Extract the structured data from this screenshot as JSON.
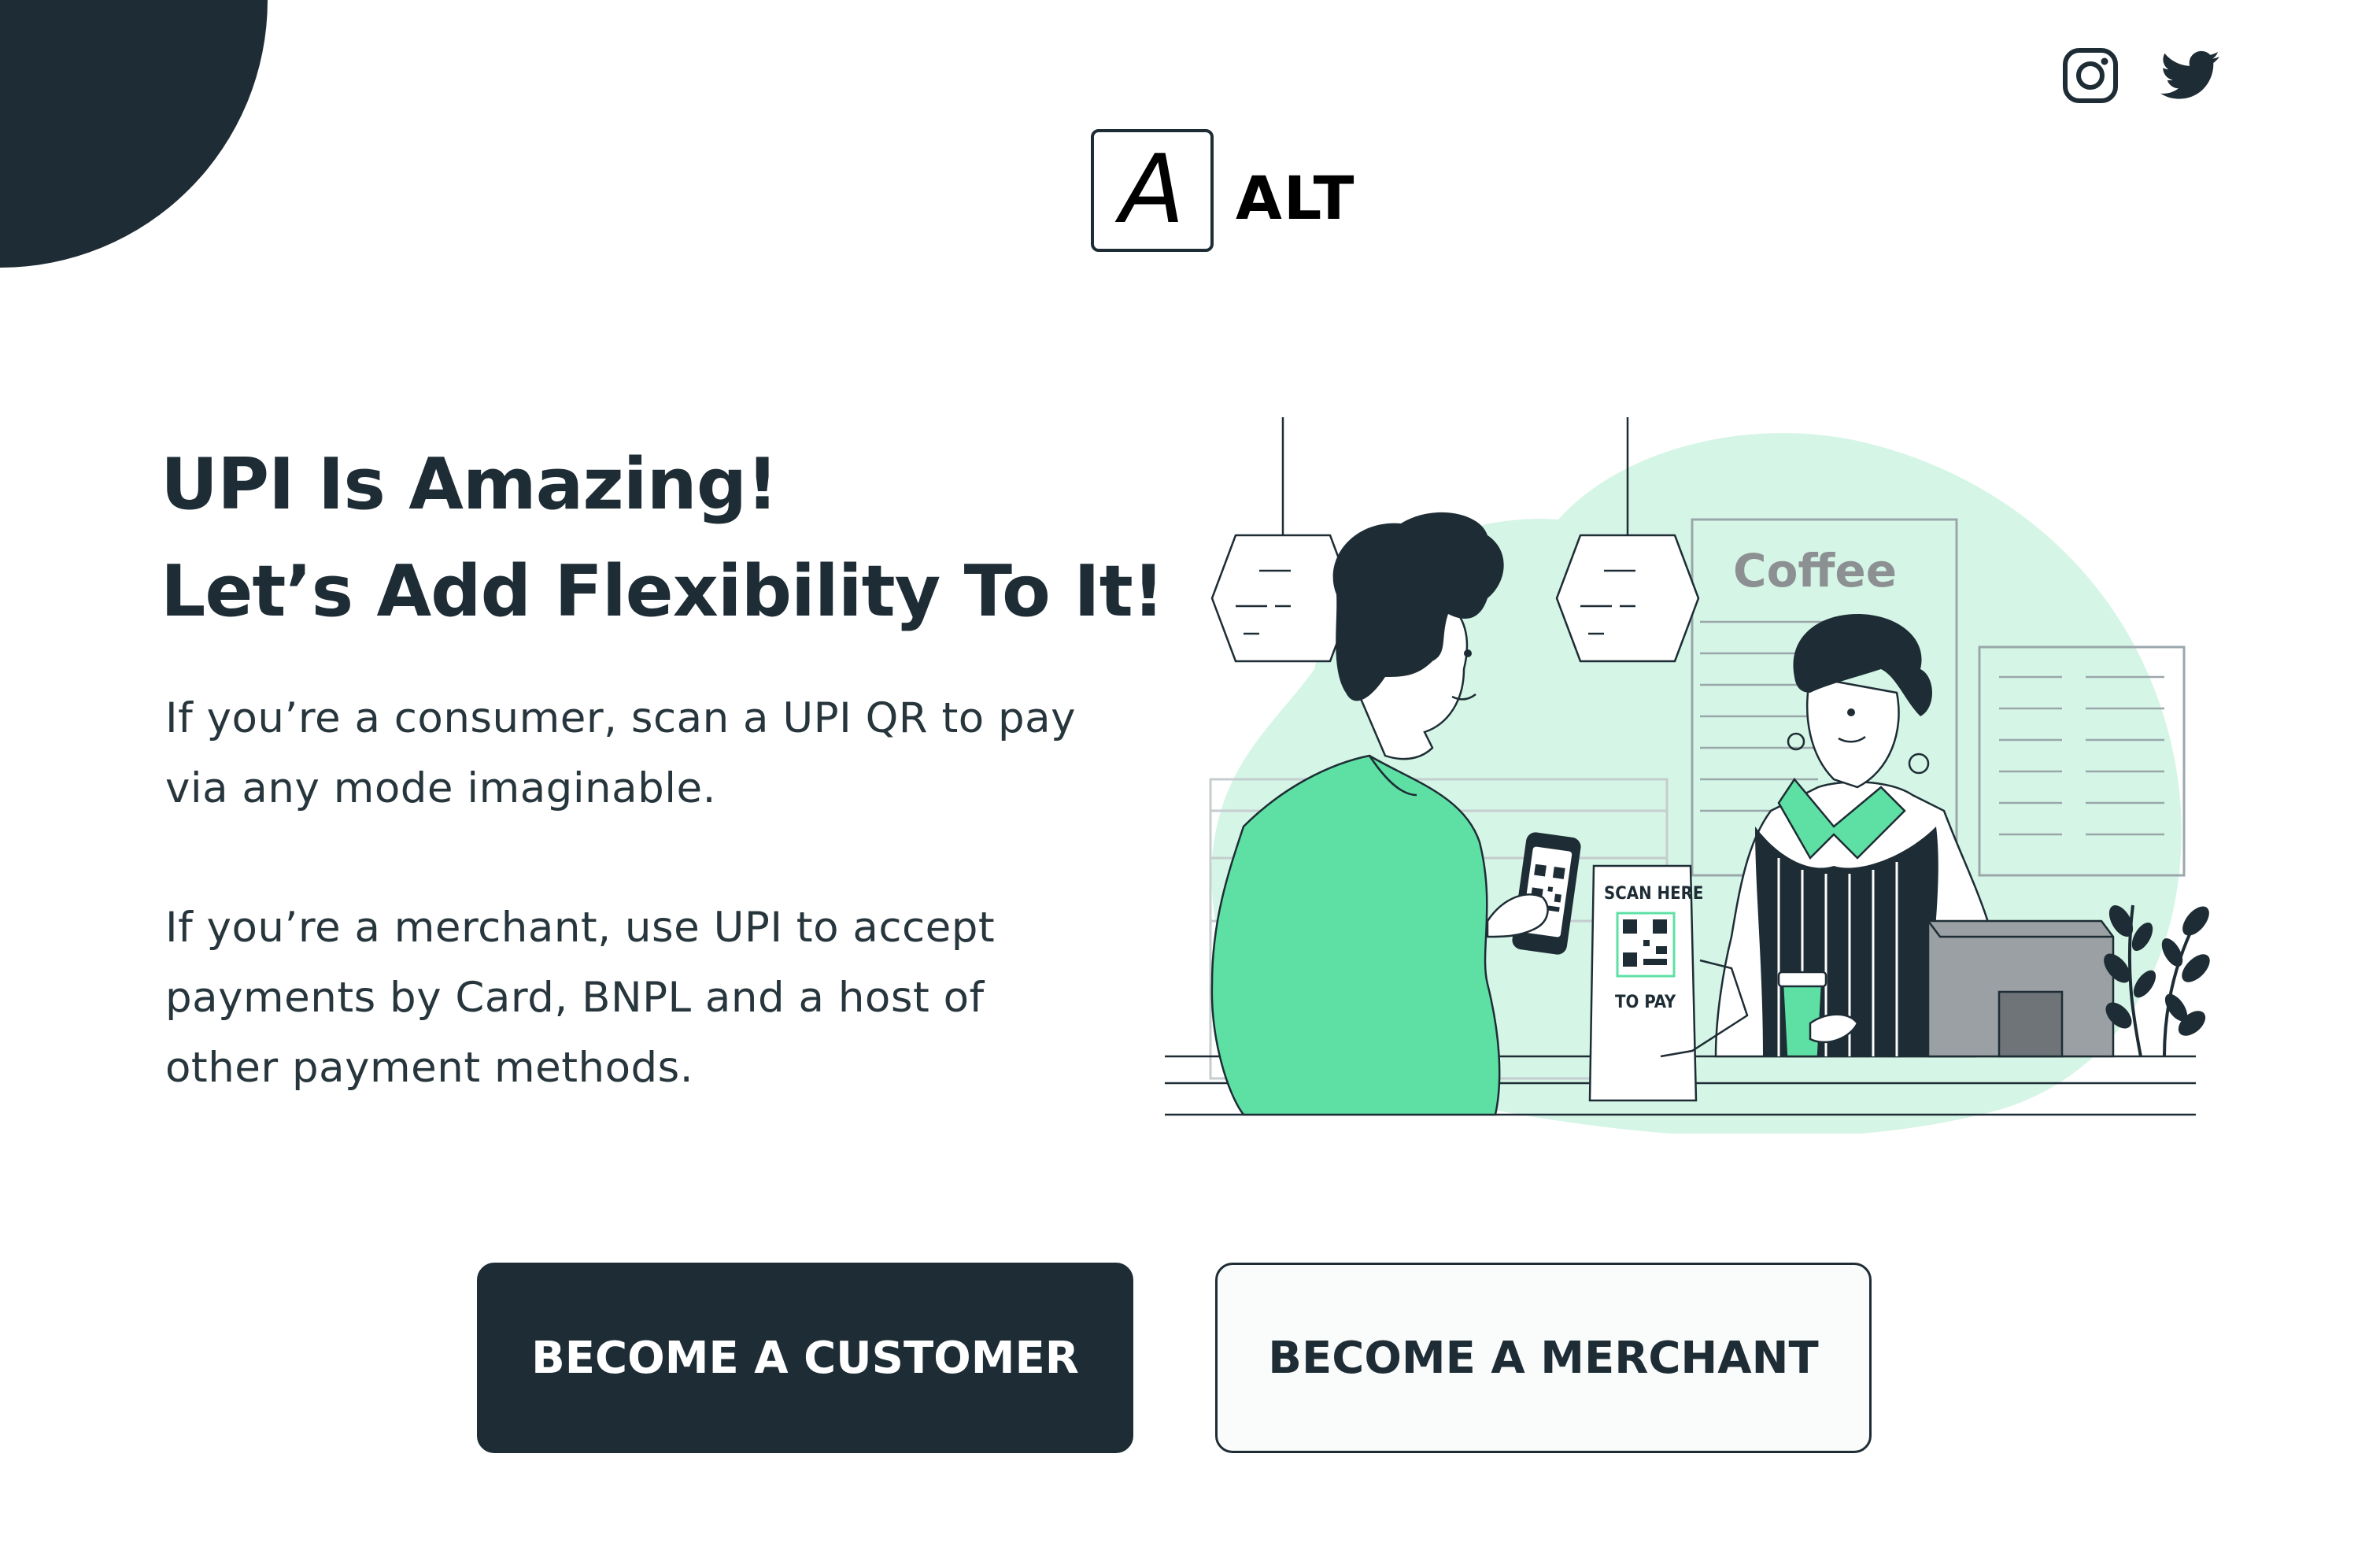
{
  "brand": {
    "logo_letter": "A",
    "name": "ALT"
  },
  "social": [
    {
      "name": "instagram",
      "icon": "instagram-icon"
    },
    {
      "name": "twitter",
      "icon": "twitter-icon"
    }
  ],
  "hero": {
    "title_line1": "UPI Is Amazing!",
    "title_line2": "Let’s Add Flexibility To It!",
    "consumer_text": "If you’re a consumer, scan a UPI QR to pay via any mode imaginable.",
    "merchant_text": "If you’re a merchant, use UPI to accept payments by Card, BNPL and a host of other payment methods."
  },
  "illustration": {
    "menu_board_title": "Coffee",
    "sign_top": "SCAN HERE",
    "sign_bottom": "TO PAY"
  },
  "cta": {
    "customer_label": "BECOME A CUSTOMER",
    "merchant_label": "BECOME A MERCHANT"
  },
  "colors": {
    "dark": "#1e2d35",
    "accent_green": "#5ee0a4",
    "mint_bg": "#d5f5e6",
    "white": "#ffffff"
  }
}
